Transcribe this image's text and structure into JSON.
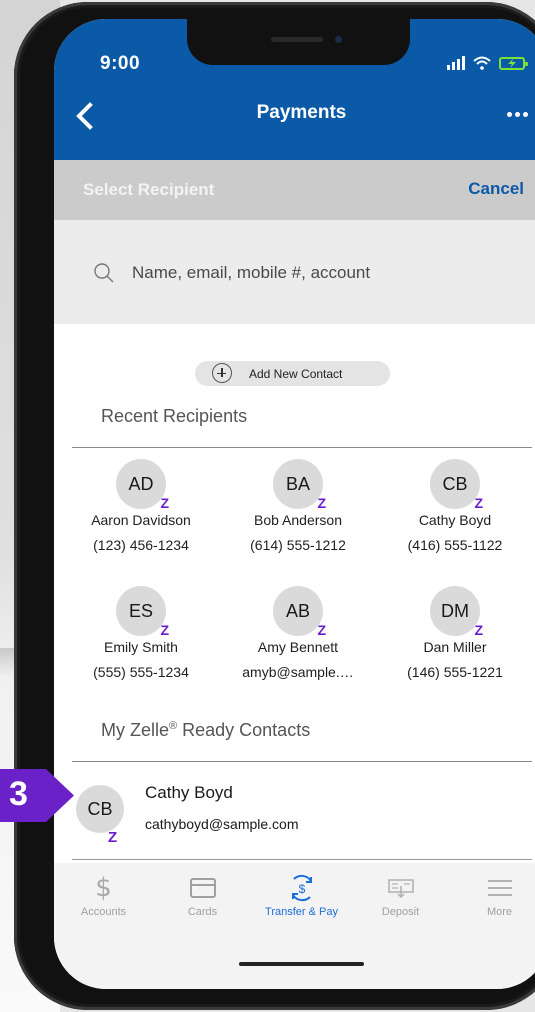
{
  "status_bar": {
    "time": "9:00"
  },
  "header": {
    "title": "Payments"
  },
  "select_bar": {
    "title": "Select Recipient",
    "cancel_label": "Cancel"
  },
  "search": {
    "placeholder": "Name, email, mobile #, account"
  },
  "add_contact": {
    "label": "Add New Contact"
  },
  "recent": {
    "heading": "Recent Recipients",
    "items": [
      {
        "initials": "AD",
        "name": "Aaron Davidson",
        "detail": "(123) 456-1234"
      },
      {
        "initials": "BA",
        "name": "Bob Anderson",
        "detail": "(614) 555-1212"
      },
      {
        "initials": "CB",
        "name": "Cathy Boyd",
        "detail": "(416) 555-1122"
      },
      {
        "initials": "ES",
        "name": "Emily Smith",
        "detail": "(555) 555-1234"
      },
      {
        "initials": "AB",
        "name": "Amy Bennett",
        "detail": "amyb@sample.…"
      },
      {
        "initials": "DM",
        "name": "Dan Miller",
        "detail": "(146) 555-1221"
      }
    ]
  },
  "zelle_section": {
    "heading_prefix": "My Zelle",
    "heading_reg": "®",
    "heading_suffix": " Ready Contacts",
    "contacts": [
      {
        "initials": "CB",
        "name": "Cathy Boyd",
        "email": "cathyboyd@sample.com"
      }
    ]
  },
  "zelle_mark": "Z",
  "tabs": [
    {
      "label": "Accounts",
      "icon": "dollar-icon"
    },
    {
      "label": "Cards",
      "icon": "card-icon"
    },
    {
      "label": "Transfer & Pay",
      "icon": "transfer-pay-icon",
      "active": true
    },
    {
      "label": "Deposit",
      "icon": "deposit-icon"
    },
    {
      "label": "More",
      "icon": "menu-icon"
    }
  ],
  "step_badge": "3",
  "colors": {
    "brand_blue": "#0b5aa8",
    "zelle_purple": "#6b1cd0",
    "step_badge": "#6b21c8",
    "active_tab": "#1a6ed8"
  }
}
